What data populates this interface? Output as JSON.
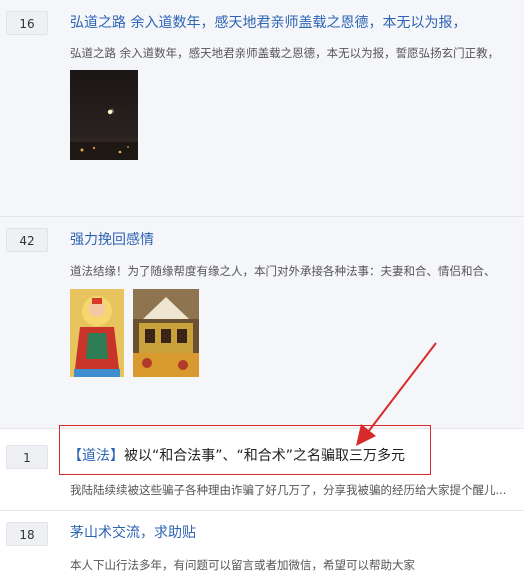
{
  "posts": [
    {
      "count": "16",
      "title": "弘道之路 余入道数年，感天地君亲师盖载之恩德，本无以为报，",
      "desc": "弘道之路 余入道数年，感天地君亲师盖载之恩德，本无以为报，誓愿弘扬玄门正教，"
    },
    {
      "count": "42",
      "title": "强力挽回感情",
      "desc": "道法结缘！为了随缘帮度有缘之人，本门对外承接各种法事：夫妻和合、情侣和合、"
    },
    {
      "count": "1",
      "tag": "【道法】",
      "title": "被以“和合法事”、“和合术”之名骗取三万多元",
      "desc": "我陆陆续续被这些骗子各种理由诈骗了好几万了，分享我被骗的经历给大家提个醒儿..."
    },
    {
      "count": "18",
      "title": "茅山术交流，求助贴",
      "desc": "本人下山行法多年，有问题可以留言或者加微信，希望可以帮助大家"
    }
  ],
  "colors": {
    "link": "#2d64b3",
    "highlight": "#d92a2a"
  }
}
